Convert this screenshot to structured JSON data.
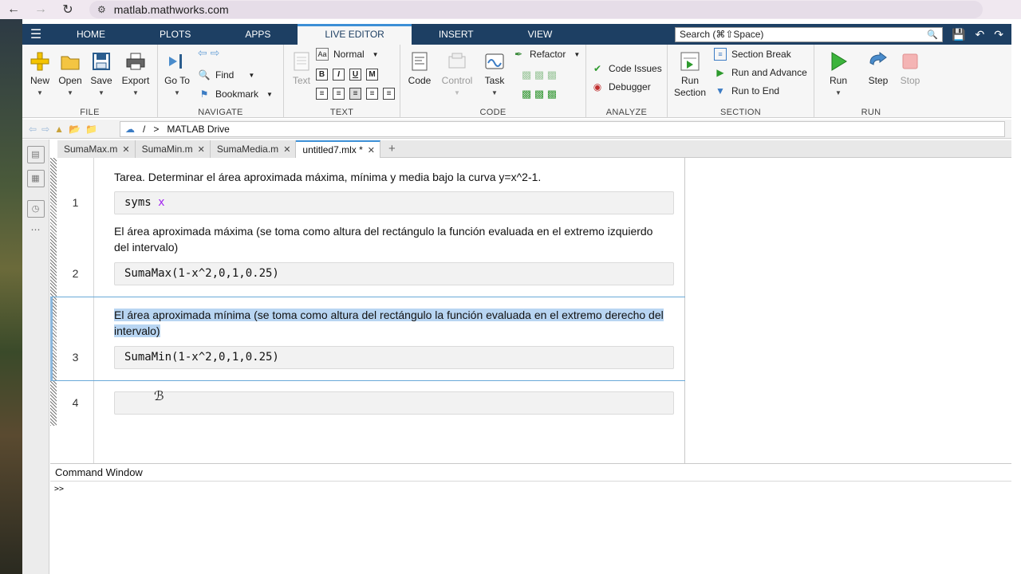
{
  "browser": {
    "url": "matlab.mathworks.com"
  },
  "tabs": [
    {
      "label": "HOME"
    },
    {
      "label": "PLOTS"
    },
    {
      "label": "APPS"
    },
    {
      "label": "LIVE EDITOR"
    },
    {
      "label": "INSERT"
    },
    {
      "label": "VIEW"
    }
  ],
  "search": {
    "placeholder": "Search (⌘⇧Space)"
  },
  "ribbon": {
    "file": {
      "label": "FILE",
      "new": "New",
      "open": "Open",
      "save": "Save",
      "export": "Export"
    },
    "navigate": {
      "label": "NAVIGATE",
      "goto": "Go To",
      "find": "Find",
      "bookmark": "Bookmark"
    },
    "text": {
      "label": "TEXT",
      "text_btn": "Text",
      "style": "Normal"
    },
    "code": {
      "label": "CODE",
      "code": "Code",
      "control": "Control",
      "task": "Task",
      "refactor": "Refactor"
    },
    "analyze": {
      "label": "ANALYZE",
      "code_issues": "Code Issues",
      "debugger": "Debugger"
    },
    "section": {
      "label": "SECTION",
      "run_section": "Run Section",
      "section_break": "Section Break",
      "run_advance": "Run and Advance",
      "run_end": "Run to End"
    },
    "run": {
      "label": "RUN",
      "run": "Run",
      "step": "Step",
      "stop": "Stop"
    }
  },
  "address": {
    "root": "/",
    "sep": ">",
    "folder": "MATLAB Drive"
  },
  "doc_tabs": [
    {
      "label": "SumaMax.m"
    },
    {
      "label": "SumaMin.m"
    },
    {
      "label": "SumaMedia.m"
    },
    {
      "label": "untitled7.mlx *"
    }
  ],
  "editor": {
    "task_text": "Tarea. Determinar el área aproximada máxima, mínima y media bajo la curva y=x^2-1.",
    "line1": {
      "num": "1",
      "code_a": "syms ",
      "code_b": "x"
    },
    "max_text_1": "El área aproximada máxima (se toma como altura del rectángulo la función evaluada en el extremo izquierdo",
    "max_text_2": "del intervalo)",
    "line2": {
      "num": "2",
      "code": "SumaMax(1-x^2,0,1,0.25)"
    },
    "min_text_1": "El área aproximada mínima (se toma como altura del rectángulo la función evaluada en el extremo derecho del",
    "min_text_2": "intervalo)",
    "line3": {
      "num": "3",
      "code": "SumaMin(1-x^2,0,1,0.25)"
    },
    "line4": {
      "num": "4",
      "code": ""
    }
  },
  "command_window": {
    "title": "Command Window",
    "prompt": ">>"
  }
}
